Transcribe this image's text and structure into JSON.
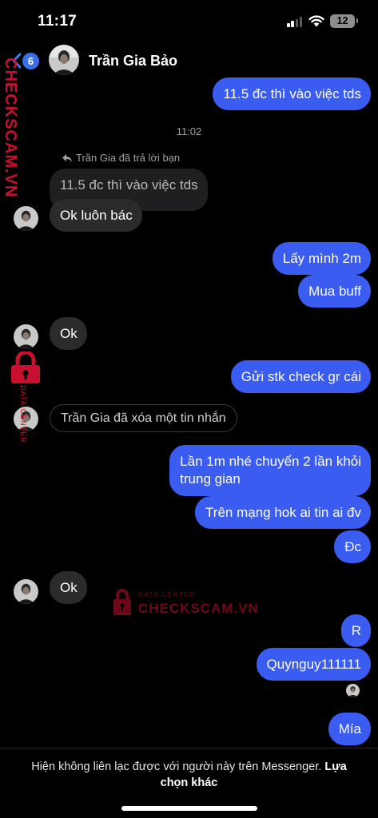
{
  "status_bar": {
    "time": "11:17",
    "battery": "12",
    "icons": [
      "signal-icon",
      "wifi-icon",
      "battery-icon"
    ]
  },
  "header": {
    "back_badge": "6",
    "contact_name": "Trần Gia Bảo",
    "icons": [
      "chevron-left-icon",
      "avatar"
    ]
  },
  "messages": {
    "m1": "11.5 đc thì vào việc tds",
    "timestamp": "11:02",
    "reply_note": "Trần Gia đã trả lời bạn",
    "quoted": "11.5 đc thì vào việc tds",
    "m2": "Ok luôn bác",
    "m3": "Lấy mình 2m",
    "m4": "Mua buff",
    "m5": "Ok",
    "m6": "Gửi stk check gr cái",
    "deleted": "Trần Gia đã xóa một tin nhắn",
    "m7_line1": "Lần 1m nhé chuyển 2 lần khỏi",
    "m7_line2": "trung gian",
    "m8": "Trên mạng hok ai tin ai đv",
    "m9": "Đc",
    "m10": "Ok",
    "m11": "R",
    "m12": "Quynguy111111",
    "m13": "Mía"
  },
  "watermark": {
    "brand": "CHECKSCAM.VN",
    "tagline": "DATA CENTER",
    "center_brand": "CHECKSCAM.VN",
    "center_tagline": "DATA CENTER"
  },
  "footer": {
    "notice": "Hiện không liên lạc được với người này trên Messenger.",
    "link": "Lựa chọn khác"
  },
  "colors": {
    "outgoing_bubble": "#3a5cf0",
    "incoming_bubble": "#2b2b2d",
    "badge": "#3b6fe8",
    "watermark": "#c8102e"
  }
}
